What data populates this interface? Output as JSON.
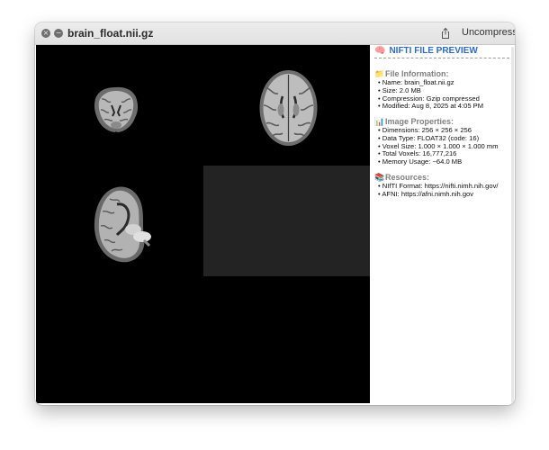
{
  "window": {
    "title": "brain_float.nii.gz",
    "uncompress_label": "Uncompress"
  },
  "preview": {
    "title": "NIFTI FILE PREVIEW",
    "title_icon": "🧠",
    "sections": [
      {
        "icon": "📁",
        "heading": "File Information:",
        "items": [
          "Name: brain_float.nii.gz",
          "Size: 2.0 MB",
          "Compression: Gzip compressed",
          "Modified: Aug 8, 2025 at 4:05 PM"
        ]
      },
      {
        "icon": "📊",
        "heading": "Image Properties:",
        "items": [
          "Dimensions: 256 × 256 × 256",
          "Data Type: FLOAT32 (code: 16)",
          "Voxel Size: 1.000 × 1.000 × 1.000 mm",
          "Total Voxels: 16,777,216",
          "Memory Usage: ~64.0 MB"
        ]
      },
      {
        "icon": "📚",
        "heading": "Resources:",
        "items": [
          "NIfTI Format: https://nifti.nimh.nih.gov/",
          "AFNI: https://afni.nimh.nih.gov"
        ]
      }
    ]
  },
  "colors": {
    "accent": "#2d6ad0",
    "viewer_background": "#000000",
    "section_heading": "#808080"
  },
  "icons": {
    "close": "close-icon",
    "minimize": "minimize-icon",
    "share": "share-icon"
  }
}
